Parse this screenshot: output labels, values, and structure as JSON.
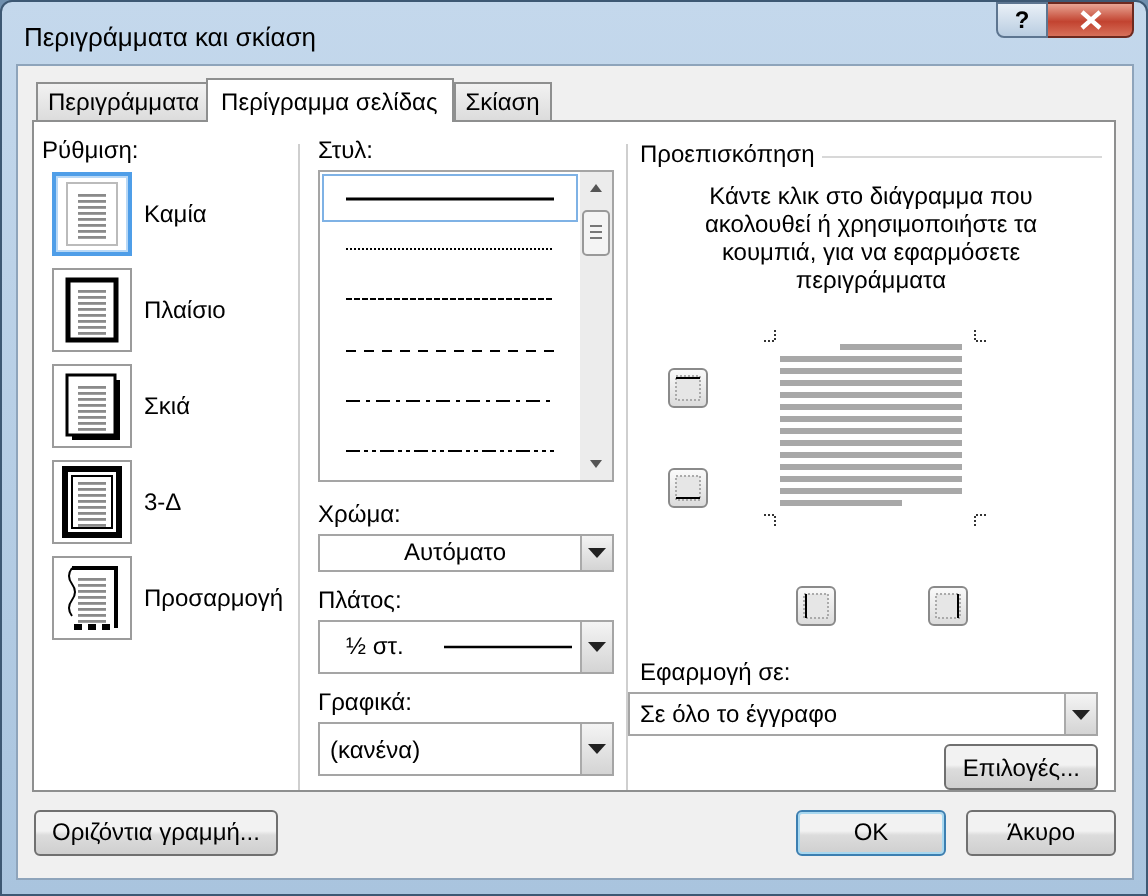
{
  "window": {
    "title": "Περιγράμματα και σκίαση",
    "help_label": "?"
  },
  "tabs": [
    {
      "label": "Περιγράμματα",
      "selected": false
    },
    {
      "label": "Περίγραμμα σελίδας",
      "selected": true
    },
    {
      "label": "Σκίαση",
      "selected": false
    }
  ],
  "setting": {
    "label": "Ρύθμιση:",
    "options": [
      {
        "kind": "none",
        "label": "Καμία",
        "selected": true
      },
      {
        "kind": "box",
        "label": "Πλαίσιο",
        "selected": false
      },
      {
        "kind": "shadow",
        "label": "Σκιά",
        "selected": false
      },
      {
        "kind": "threed",
        "label": "3-Δ",
        "selected": false
      },
      {
        "kind": "custom",
        "label": "Προσαρμογή",
        "selected": false
      }
    ]
  },
  "style": {
    "label": "Στυλ:",
    "lines": [
      {
        "kind": "solid",
        "selected": true
      },
      {
        "kind": "dotted",
        "selected": false
      },
      {
        "kind": "fine-dash",
        "selected": false
      },
      {
        "kind": "dash",
        "selected": false
      },
      {
        "kind": "dash-dot",
        "selected": false
      },
      {
        "kind": "dash-dot-dot",
        "selected": false
      }
    ]
  },
  "color": {
    "label": "Χρώμα:",
    "value": "Αυτόματο"
  },
  "width": {
    "label": "Πλάτος:",
    "value": "½ στ."
  },
  "art": {
    "label": "Γραφικά:",
    "value": "(κανένα)"
  },
  "preview": {
    "title": "Προεπισκόπηση",
    "instructions": "Κάντε κλικ στο διάγραμμα που ακολουθεί ή χρησιμοποιήστε τα κουμπιά, για να εφαρμόσετε περιγράμματα"
  },
  "apply_to": {
    "label": "Εφαρμογή σε:",
    "value": "Σε όλο το έγγραφο"
  },
  "options_button": "Επιλογές...",
  "footer": {
    "horizontal_line_button": "Οριζόντια γραμμή...",
    "ok": "OK",
    "cancel": "Άκυρο"
  }
}
